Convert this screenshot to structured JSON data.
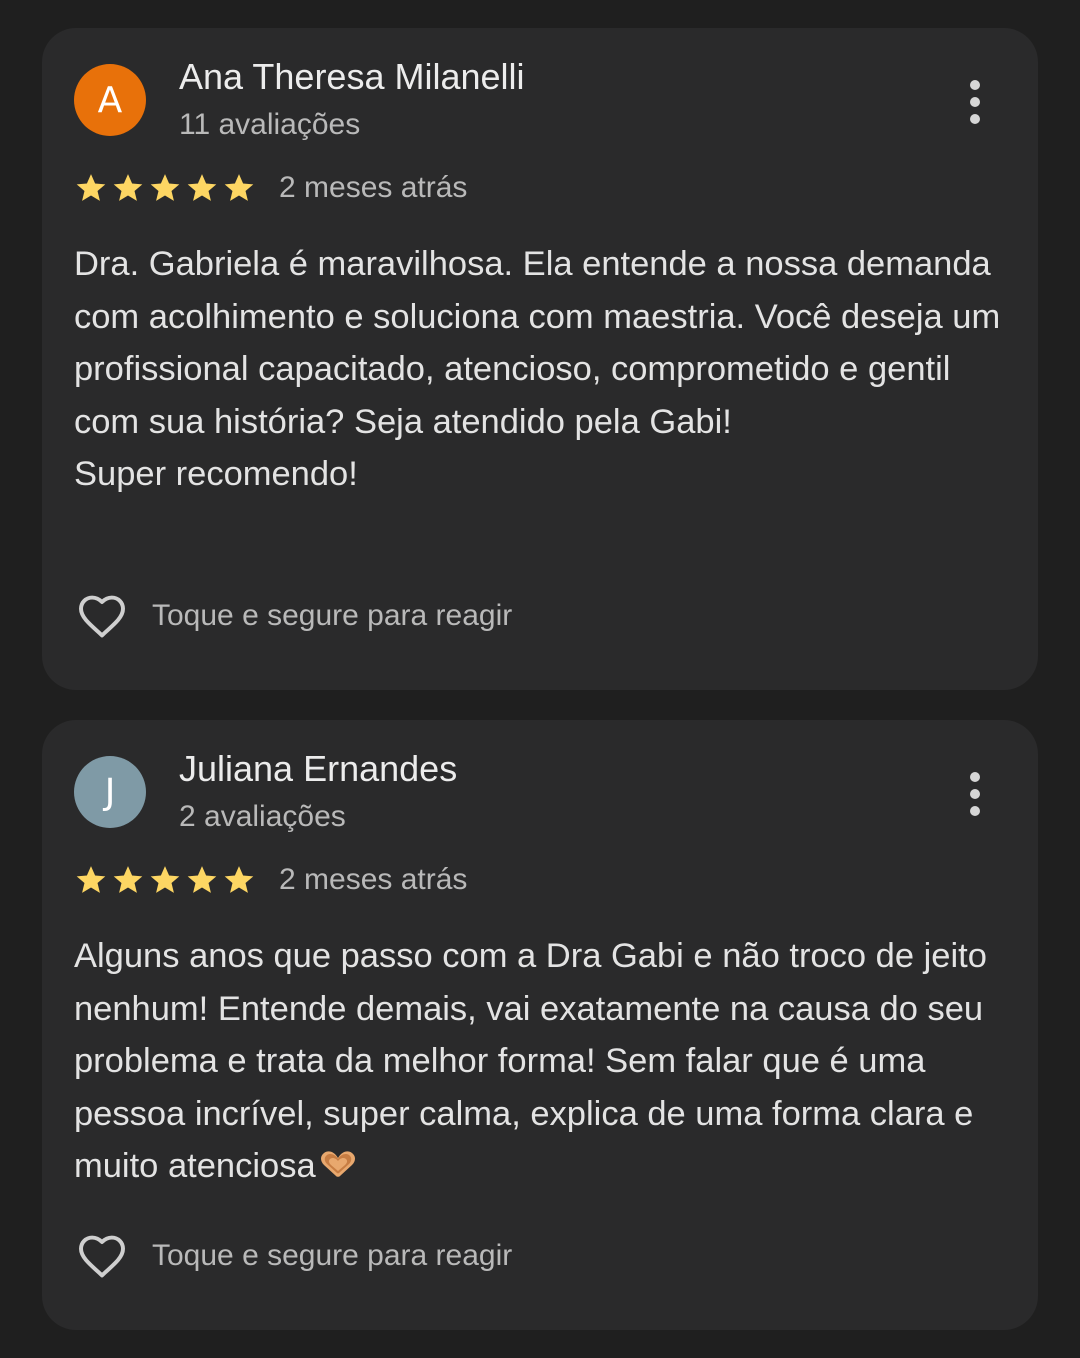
{
  "reviews": [
    {
      "avatar_letter": "A",
      "avatar_color": "#e8710a",
      "name": "Ana Theresa Milanelli",
      "review_count": "11 avaliações",
      "rating": 5,
      "date": "2 meses atrás",
      "text": "Dra. Gabriela é maravilhosa. Ela entende a nossa demanda com acolhimento e soluciona com maestria. Você deseja um profissional capacitado, atencioso, comprometido e gentil com sua história? Seja atendido pela Gabi!\nSuper recomendo!",
      "react_label": "Toque e segure para reagir"
    },
    {
      "avatar_letter": "J",
      "avatar_color": "#7f9aa6",
      "name": "Juliana Ernandes",
      "review_count": "2 avaliações",
      "rating": 5,
      "date": "2 meses atrás",
      "text": "Alguns anos que passo com a Dra Gabi e não troco de jeito nenhum! Entende demais, vai exatamente na causa do seu problema e trata da melhor forma! Sem falar que é uma pessoa incrível, super calma, explica de uma forma clara e muito atenciosa",
      "text_emoji": "heart-hands-emoji",
      "react_label": "Toque e segure para reagir"
    }
  ],
  "star_color": "#fdd663"
}
